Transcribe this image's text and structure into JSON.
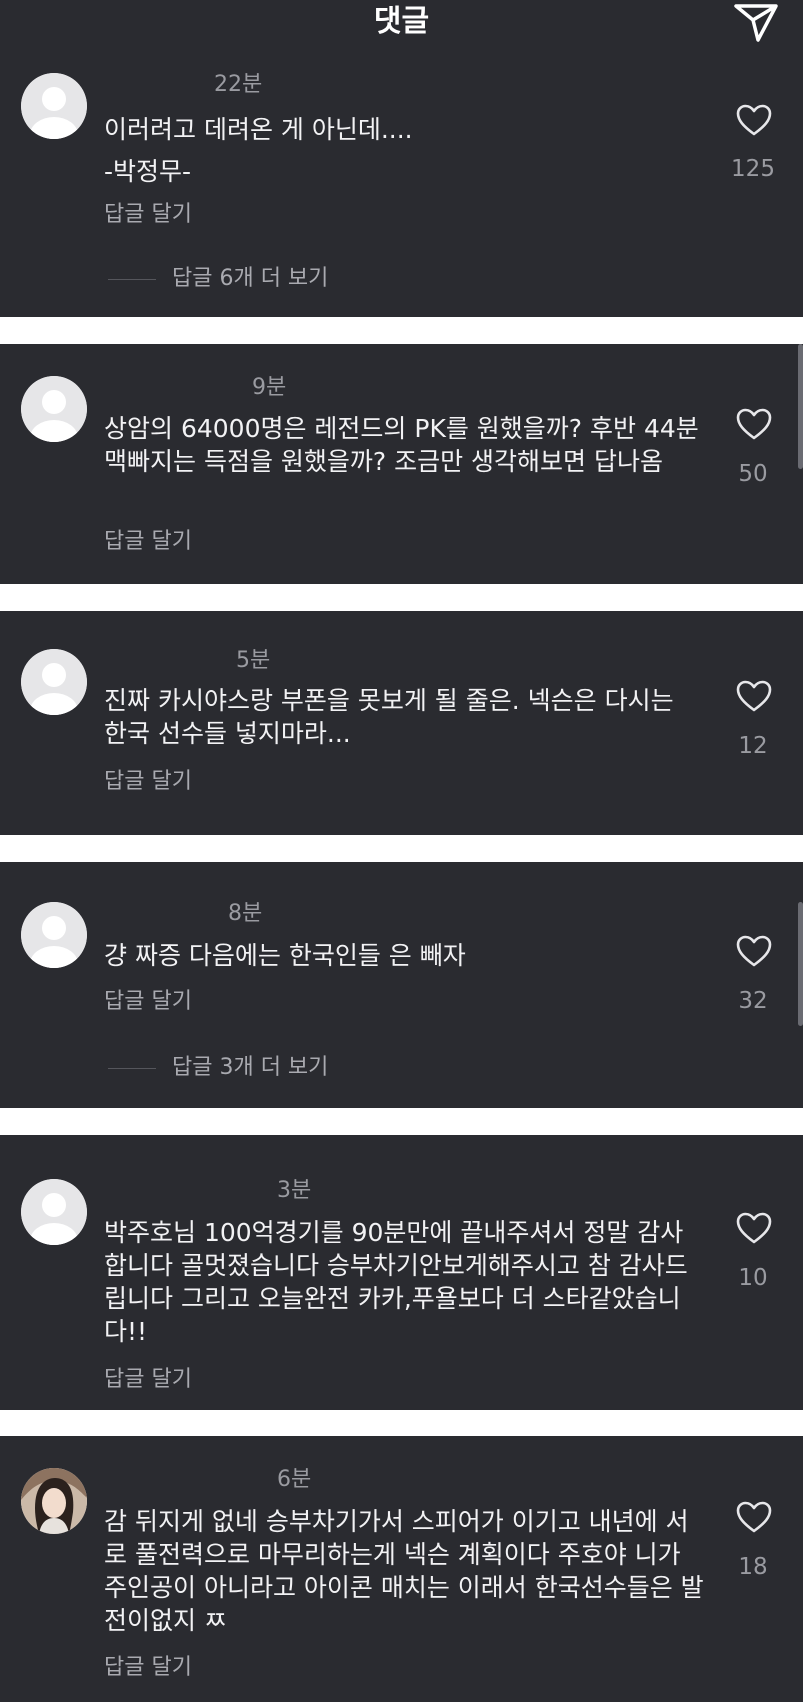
{
  "header": {
    "title": "댓글",
    "send_icon": "send-paper-plane-icon"
  },
  "comments": [
    {
      "time": "22분",
      "text": "이러려고 데려온 게 아닌데....\n-박정무-",
      "reply": "답글 달기",
      "likes": "125",
      "more_replies": "답글 6개 더 보기"
    },
    {
      "time": "9분",
      "text": "상암의 64000명은 레전드의 PK를 원했을까? 후반 44분 맥빠지는 득점을 원했을까? 조금만 생각해보면 답나옴",
      "reply": "답글 달기",
      "likes": "50"
    },
    {
      "time": "5분",
      "text": "진짜 카시야스랑 부폰을 못보게 될 줄은. 넥슨은 다시는 한국 선수들 넣지마라...",
      "reply": "답글 달기",
      "likes": "12"
    },
    {
      "time": "8분",
      "text": "걍 짜증 다음에는 한국인들 은 빼자",
      "reply": "답글 달기",
      "likes": "32",
      "more_replies": "답글 3개 더 보기"
    },
    {
      "time": "3분",
      "text": "박주호님 100억경기를 90분만에 끝내주셔서 정말 감사합니다 골멋졌습니다 승부차기안보게해주시고 참 감사드립니다 그리고 오늘완전 카카,푸욜보다 더 스타같았습니다!!",
      "reply": "답글 달기",
      "likes": "10"
    },
    {
      "time": "6분",
      "text": "감 뒤지게 없네 승부차기가서 스피어가 이기고 내년에 서로 풀전력으로 마무리하는게 넥슨 계획이다 주호야 니가 주인공이 아니라고 아이콘 매치는 이래서 한국선수들은 발전이없지 ㅉ",
      "reply": "답글 달기",
      "likes": "18"
    }
  ],
  "colors": {
    "panel": "#2a2b30",
    "separator": "#ffffff",
    "text": "#f2f2f4",
    "muted": "#9a9ba1"
  }
}
